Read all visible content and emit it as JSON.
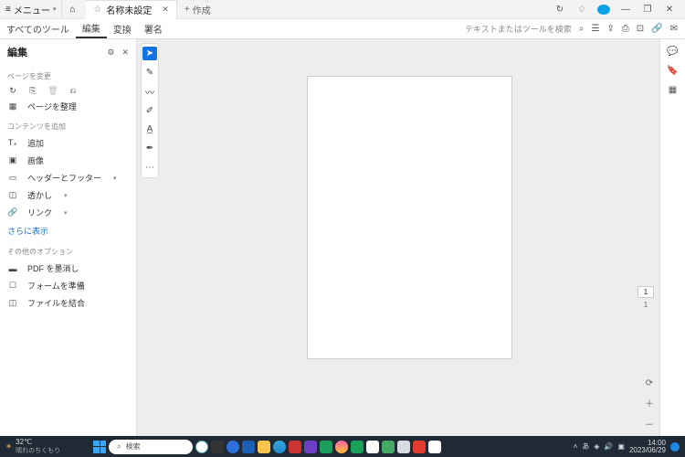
{
  "titlebar": {
    "menu": "メニュー",
    "tab_title": "名称未設定",
    "new_tab": "作成"
  },
  "toolbar": {
    "tabs": [
      "すべてのツール",
      "編集",
      "変換",
      "署名"
    ],
    "active": 1,
    "search_placeholder": "テキストまたはツールを検索"
  },
  "side_left": {
    "title": "編集",
    "section_page": "ページを変更",
    "organize": "ページを整理",
    "section_add": "コンテンツを追加",
    "add_text": "追加",
    "image": "画像",
    "header_footer": "ヘッダーとフッター",
    "watermark": "透かし",
    "link": "リンク",
    "show_more": "さらに表示",
    "section_other": "その他のオプション",
    "redact": "PDF を墨消し",
    "prepare_form": "フォームを準備",
    "combine": "ファイルを結合"
  },
  "doc": {
    "page_num": "1",
    "page_total": "1"
  },
  "taskbar": {
    "temp": "32℃",
    "weather_text": "晴れのちくもり",
    "search": "検索",
    "ime": "あ",
    "time": "14:00",
    "date": "2023/06/29"
  }
}
